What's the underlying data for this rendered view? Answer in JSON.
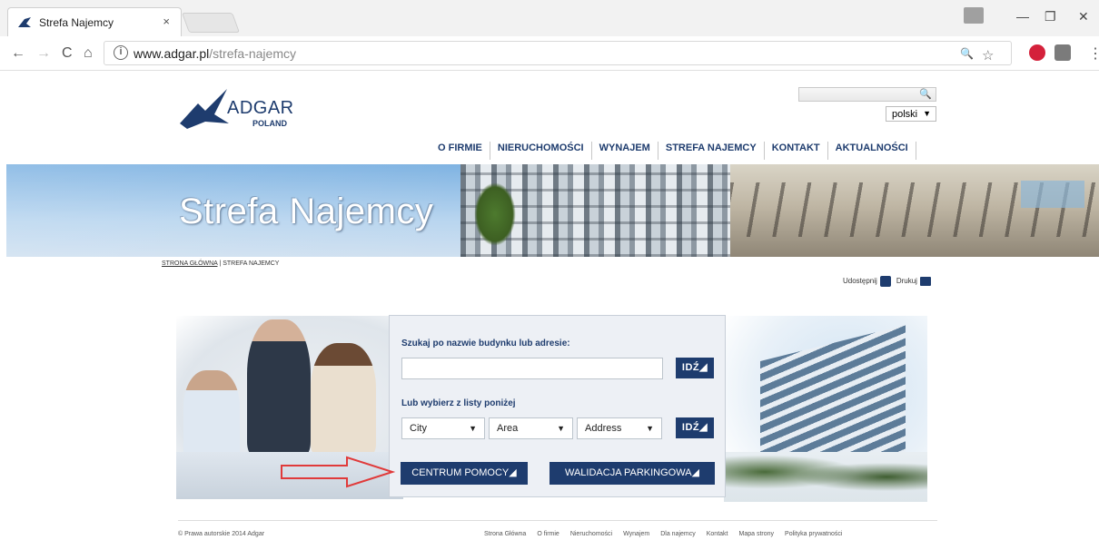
{
  "browser": {
    "tab_title": "Strefa Najemcy",
    "tab_close": "×",
    "url_domain": "www.adgar.pl",
    "url_path": "/strefa-najemcy",
    "back": "←",
    "forward": "→",
    "reload": "C",
    "home": "⌂",
    "zoom_icon": "🔍",
    "star_icon": "☆",
    "menu_icon": "⋮",
    "minimize": "—",
    "restore": "❐",
    "close": "✕",
    "info_glyph": "i"
  },
  "header": {
    "logo_word": "ADGAR",
    "logo_sub": "POLAND",
    "search_icon_glyph": "🔍",
    "language": "polski",
    "dropdown_glyph": "▼"
  },
  "nav": {
    "items": [
      "O FIRMIE",
      "NIERUCHOMOŚCI",
      "WYNAJEM",
      "STREFA NAJEMCY",
      "KONTAKT",
      "AKTUALNOŚCI"
    ]
  },
  "banner": {
    "heading": "Strefa Najemcy"
  },
  "breadcrumb": {
    "home": "STRONA GŁÓWNA",
    "separator": " | ",
    "current": "STREFA NAJEMCY"
  },
  "share": {
    "share_label": "Udostępnij",
    "print_label": "Drukuj"
  },
  "search_panel": {
    "search_label": "Szukaj po nazwie budynku lub adresie:",
    "search_value": "",
    "go_label": "IDŹ◢",
    "list_label": "Lub wybierz z listy poniżej",
    "city": "City",
    "area": "Area",
    "address": "Address",
    "dropdown_glyph": "▼",
    "help_center": "CENTRUM POMOCY◢",
    "parking": "WALIDACJA PARKINGOWA◢"
  },
  "footer": {
    "copyright": "© Prawa autorskie 2014 Adgar",
    "links": [
      "Strona Główna",
      "O firmie",
      "Nieruchomości",
      "Wynajem",
      "Dla najemcy",
      "Kontakt",
      "Mapa strony",
      "Polityka prywatności"
    ]
  },
  "colors": {
    "brand_navy": "#1e3c6e",
    "panel_bg": "#edf0f5",
    "arrow_red": "#e03a3a"
  }
}
